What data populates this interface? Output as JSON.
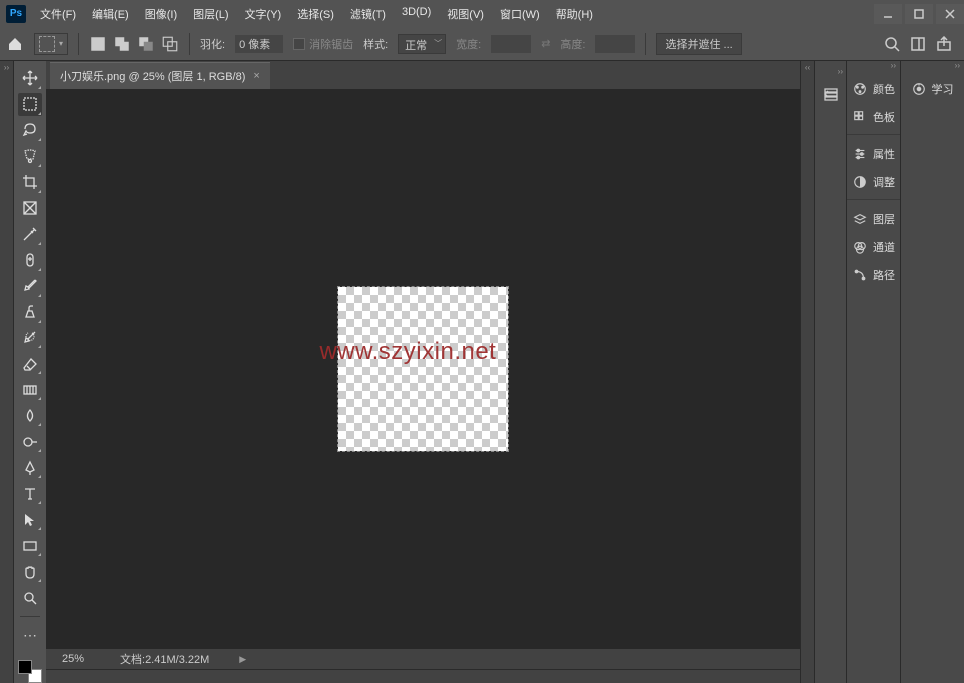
{
  "app": {
    "logo": "Ps"
  },
  "menu": {
    "file": "文件(F)",
    "edit": "编辑(E)",
    "image": "图像(I)",
    "layer": "图层(L)",
    "type": "文字(Y)",
    "select": "选择(S)",
    "filter": "滤镜(T)",
    "threed": "3D(D)",
    "view": "视图(V)",
    "window": "窗口(W)",
    "help": "帮助(H)"
  },
  "options": {
    "feather_label": "羽化:",
    "feather_value": "0 像素",
    "antialias": "消除锯齿",
    "style_label": "样式:",
    "style_value": "正常",
    "width_label": "宽度:",
    "width_value": "",
    "height_label": "高度:",
    "height_value": "",
    "select_mask": "选择并遮住 ..."
  },
  "document": {
    "tab_title": "小刀娱乐.png @ 25% (图层 1, RGB/8)",
    "watermark": "www.szyixin.net",
    "zoom": "25%",
    "doc_label": "文档:",
    "doc_size": "2.41M/3.22M"
  },
  "panels": {
    "color": "颜色",
    "swatches": "色板",
    "properties": "属性",
    "adjustments": "调整",
    "layers": "图层",
    "channels": "通道",
    "paths": "路径",
    "learn": "学习"
  }
}
